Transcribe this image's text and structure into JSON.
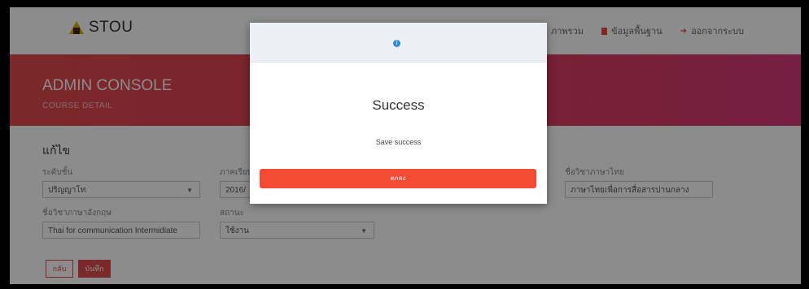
{
  "brand": {
    "name": "STOU"
  },
  "nav": [
    {
      "label": "ภาพรวม"
    },
    {
      "label": "ข้อมูลพื้นฐาน"
    },
    {
      "label": "ออกจากระบบ"
    }
  ],
  "header": {
    "title": "ADMIN CONSOLE",
    "subtitle": "COURSE DETAIL"
  },
  "form": {
    "title": "แก้ไข",
    "level_label": "ระดับชั้น",
    "level_value": "ปริญญาโท",
    "term_label": "ภาคเรียน",
    "term_value": "2016/",
    "course_th_label": "ชื่อวิชาภาษาไทย",
    "course_th_value": "ภาษาไทยเพื่อการสื่อสารปานกลาง",
    "course_en_label": "ชื่อวิชาภาษาอังกฤษ",
    "course_en_value": "Thai for communication Intermidiate",
    "status_label": "สถานะ",
    "status_value": "ใช้งาน",
    "back_label": "กลับ",
    "save_label": "บันทึก"
  },
  "modal": {
    "icon": "info-icon",
    "title": "Success",
    "message": "Save success",
    "ok_label": "ตกลง"
  },
  "colors": {
    "accent": "#e04a4d",
    "modal_button": "#f24a33",
    "info": "#2e8bd6"
  }
}
